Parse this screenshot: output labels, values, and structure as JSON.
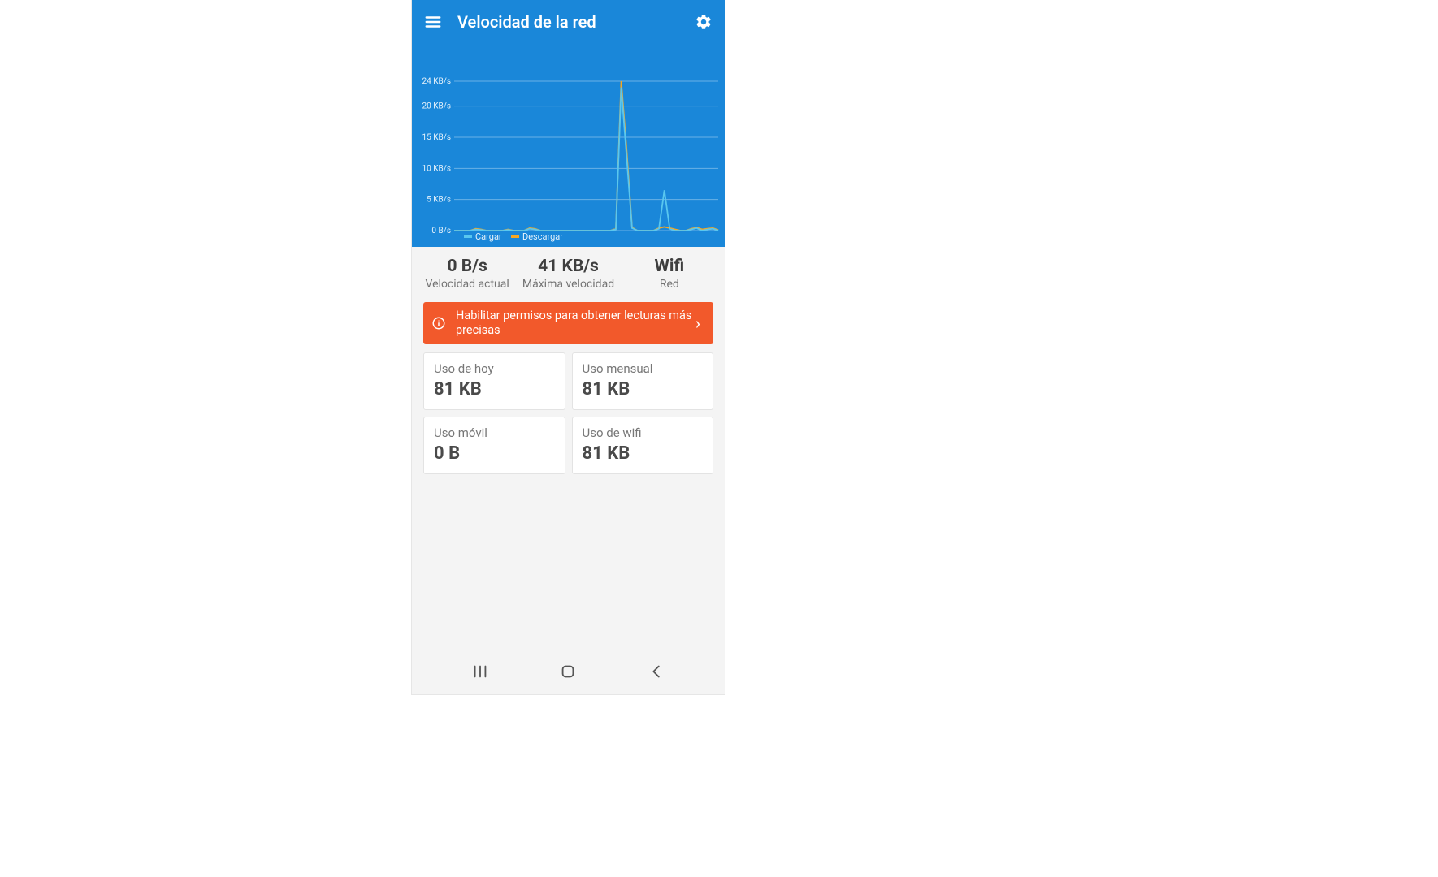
{
  "appbar": {
    "title": "Velocidad de la red"
  },
  "chart_data": {
    "type": "line",
    "title": "",
    "xlabel": "",
    "ylabel": "",
    "ylim": [
      0,
      24
    ],
    "y_unit": "KB/s",
    "y_ticks": [
      "0 B/s",
      "5 KB/s",
      "10 KB/s",
      "15 KB/s",
      "20 KB/s",
      "24 KB/s"
    ],
    "legend": [
      "Cargar",
      "Descargar"
    ],
    "x": [
      0,
      1,
      2,
      3,
      4,
      5,
      6,
      7,
      8,
      9,
      10,
      11,
      12,
      13,
      14,
      15,
      16,
      17,
      18,
      19,
      20,
      21,
      22,
      23,
      24,
      25,
      26,
      27,
      28,
      29,
      30,
      31,
      32,
      33,
      34,
      35,
      36,
      37,
      38,
      39,
      40,
      41,
      42,
      43,
      44,
      45,
      46,
      47,
      48,
      49
    ],
    "series": [
      {
        "name": "Cargar",
        "values": [
          0,
          0,
          0,
          0,
          0.2,
          0.1,
          0,
          0,
          0,
          0,
          0.1,
          0,
          0,
          0,
          0.3,
          0.2,
          0,
          0,
          0,
          0,
          0,
          0,
          0,
          0,
          0,
          0,
          0,
          0,
          0,
          0,
          0.2,
          23.0,
          12.0,
          0.4,
          0,
          0,
          0,
          0,
          0.3,
          6.5,
          0.3,
          0,
          0,
          0,
          0.2,
          0.4,
          0,
          0.2,
          0.3,
          0
        ]
      },
      {
        "name": "Descargar",
        "values": [
          0,
          0,
          0,
          0,
          0.3,
          0.2,
          0,
          0,
          0,
          0,
          0.2,
          0,
          0,
          0,
          0.4,
          0.3,
          0,
          0,
          0,
          0,
          0,
          0,
          0,
          0,
          0,
          0,
          0,
          0,
          0,
          0,
          0.3,
          24.0,
          13.0,
          0.5,
          0,
          0,
          0,
          0,
          0.4,
          0.6,
          0.4,
          0.2,
          0,
          0,
          0.3,
          0.5,
          0.2,
          0.3,
          0.4,
          0.1
        ]
      }
    ]
  },
  "stats": {
    "current": {
      "value": "0 B/s",
      "label": "Velocidad actual"
    },
    "max": {
      "value": "41 KB/s",
      "label": "Máxima velocidad"
    },
    "net": {
      "value": "Wifi",
      "label": "Red"
    }
  },
  "banner": {
    "text": "Habilitar permisos para obtener lecturas más precisas"
  },
  "usage": {
    "today": {
      "label": "Uso de hoy",
      "value": "81 KB"
    },
    "monthly": {
      "label": "Uso mensual",
      "value": "81 KB"
    },
    "mobile": {
      "label": "Uso móvil",
      "value": "0 B"
    },
    "wifi": {
      "label": "Uso de wifi",
      "value": "81 KB"
    }
  },
  "colors": {
    "primary": "#1a87d9",
    "upload": "#59c7ef",
    "download": "#f6a722",
    "banner": "#f2592b"
  }
}
